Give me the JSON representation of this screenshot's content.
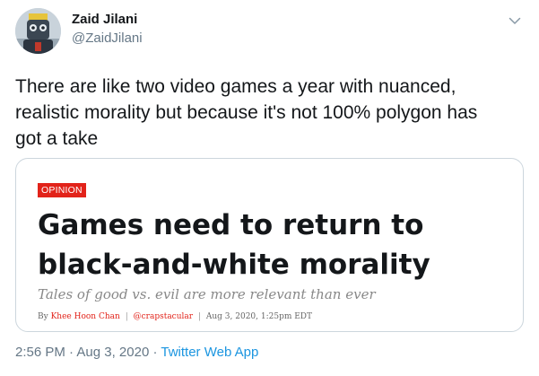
{
  "author": {
    "name": "Zaid Jilani",
    "handle": "@ZaidJilani",
    "avatar_icon": "avatar-icon"
  },
  "tweet": {
    "text_lines": [
      "There are like two video games a year with nuanced,",
      "realistic morality but because it's not 100% polygon has",
      "got a take"
    ]
  },
  "card": {
    "badge": "OPINION",
    "headline_lines": [
      "Games need to return to",
      "black-and-white morality"
    ],
    "subhead": "Tales of good vs. evil are more relevant than ever",
    "byline": {
      "prefix": "By",
      "author": "Khee Hoon Chan",
      "sep1": "|",
      "twitter": "@crapstacular",
      "sep2": "|",
      "date": "Aug 3, 2020, 1:25pm EDT"
    }
  },
  "meta": {
    "time": "2:56 PM",
    "dot": "·",
    "date": "Aug 3, 2020",
    "source": "Twitter Web App"
  },
  "colors": {
    "accent": "#1b95e0",
    "badge": "#e2231a",
    "muted": "#657786"
  }
}
